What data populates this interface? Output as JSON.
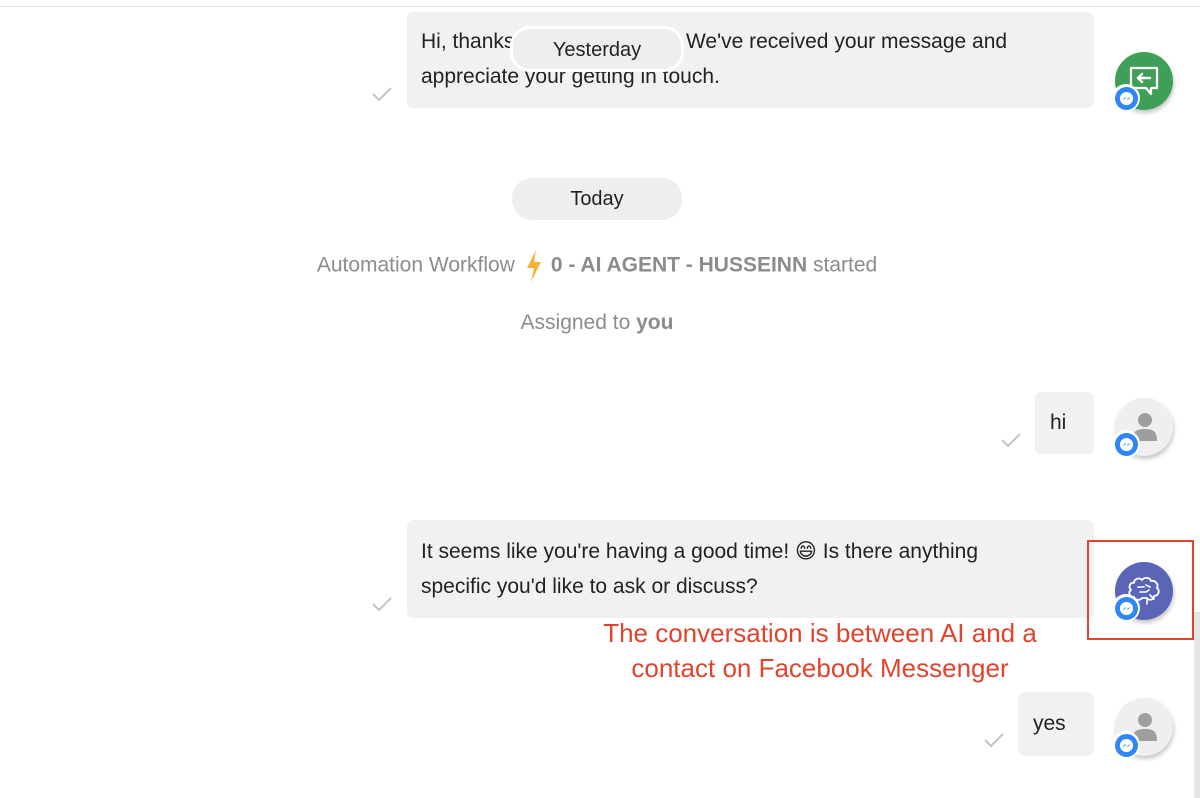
{
  "separators": {
    "yesterday": "Yesterday",
    "today": "Today"
  },
  "messages": [
    {
      "id": "welcome",
      "sender": "bot-inbound-workflow",
      "lines": [
        "Hi, thanks for contacting us. We've received your message and",
        "appreciate your getting in touch."
      ],
      "status": "sent",
      "channel": "facebook-messenger"
    },
    {
      "id": "hi",
      "sender": "contact",
      "text": "hi",
      "status": "sent",
      "channel": "facebook-messenger"
    },
    {
      "id": "ai-reply",
      "sender": "ai-agent",
      "lines": [
        "It seems like you're having a good time! 😄 Is there anything",
        "specific you'd like to ask or discuss?"
      ],
      "status": "sent",
      "channel": "facebook-messenger"
    },
    {
      "id": "yes",
      "sender": "contact",
      "text": "yes",
      "status": "sent",
      "channel": "facebook-messenger"
    }
  ],
  "system_events": {
    "workflow": {
      "prefix": "Automation Workflow",
      "name": "0 - AI AGENT - HUSSEINN",
      "suffix": "started"
    },
    "assignment": {
      "prefix": "Assigned to",
      "assignee": "you"
    }
  },
  "annotation": {
    "text_line1": "The conversation is between AI and a",
    "text_line2": "contact on Facebook Messenger"
  },
  "colors": {
    "annotation": "#e0442e",
    "messenger": "#2f86f6",
    "workflow_avatar": "#3f9f56",
    "ai_avatar": "#5b65b8",
    "bolt": "#f5b335"
  }
}
